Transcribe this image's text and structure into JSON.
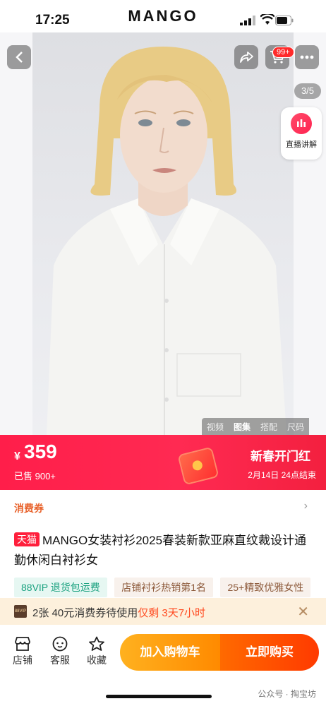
{
  "status_bar": {
    "time": "17:25",
    "brand": "MANGO"
  },
  "header": {
    "back_icon": "chevron-left-icon",
    "share_icon": "share-icon",
    "cart_icon": "cart-icon",
    "cart_badge": "99+",
    "more_icon": "more-dots-icon"
  },
  "gallery": {
    "counter": "3/5",
    "live_label": "直播讲解",
    "tabs": [
      "视频",
      "图集",
      "搭配",
      "尺码"
    ],
    "active_tab": "图集"
  },
  "price": {
    "currency": "¥",
    "amount": "359",
    "sold": "已售 900+",
    "promo_title": "新春开门红",
    "promo_ends": "2月14日 24点结束"
  },
  "coupon": {
    "label": "消费券"
  },
  "product": {
    "store_badge": "天猫",
    "title": "MANGO女装衬衫2025春装新款亚麻直纹裁设计通勤休闲白衬衫女"
  },
  "tags": [
    "88VIP 退货包运费",
    "店铺衬衫热销第1名",
    "25+精致优雅女性"
  ],
  "notice": {
    "vip_logo": "88VIP",
    "text_prefix": "2张 40元消费券待使用",
    "text_highlight": "仅剩 3天7小时"
  },
  "bottom_nav": {
    "store_label": "店铺",
    "service_label": "客服",
    "favorite_label": "收藏",
    "add_to_cart": "加入购物车",
    "buy_now": "立即购买"
  },
  "watermark": "公众号 · 掏宝坊",
  "colors": {
    "accent_red": "#ff1e4a",
    "cart_orange": "#ffa010",
    "buy_orange": "#ff4a00"
  }
}
